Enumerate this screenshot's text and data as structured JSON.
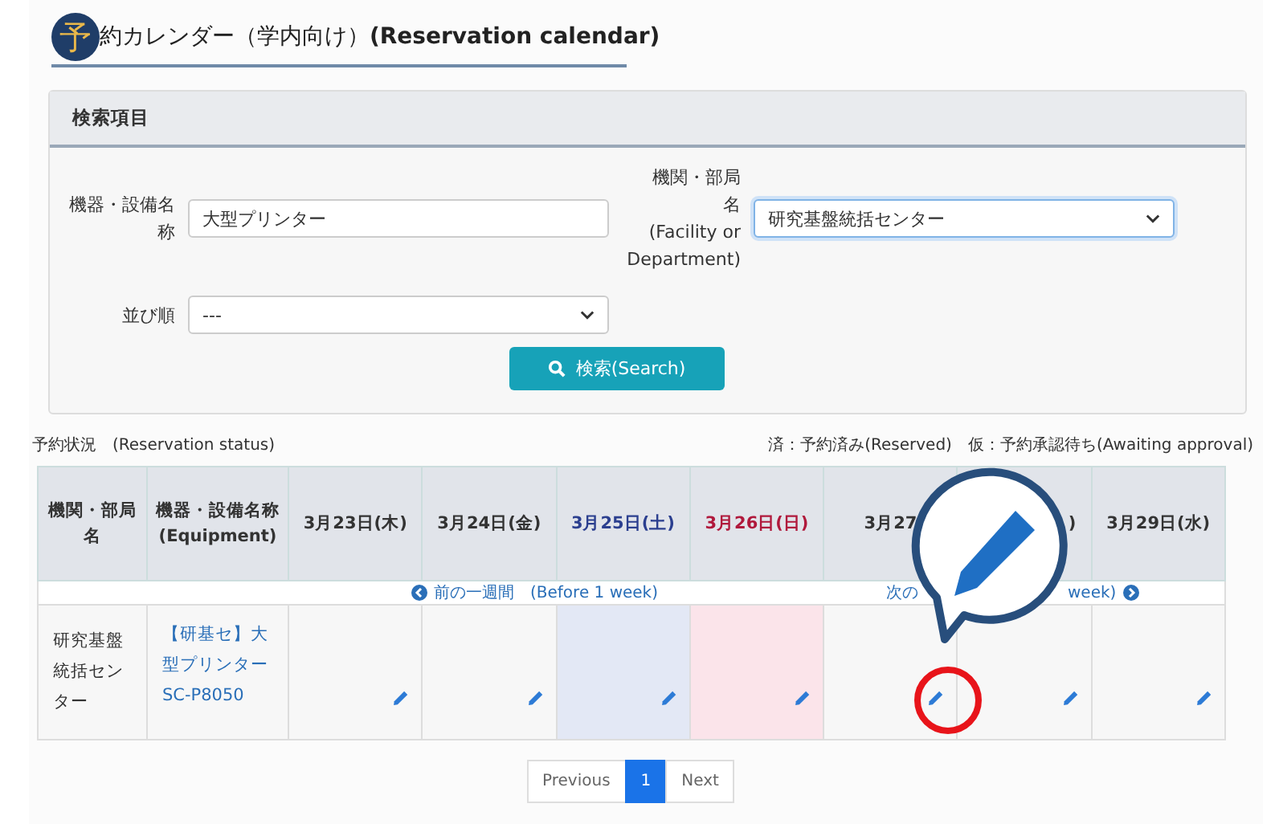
{
  "title": {
    "badge": "予",
    "text": "約カレンダー（学内向け）**(Reservation calendar)**"
  },
  "search": {
    "header": "検索項目",
    "equipment_label": "機器・設備名称",
    "equipment_value": "大型プリンター",
    "facility_label": [
      "機関・部局",
      "名",
      "(Facility or",
      "Department)"
    ],
    "facility_value": "研究基盤統括センター",
    "order_label": "並び順",
    "order_value": "---",
    "button": "検索(Search)"
  },
  "status": {
    "left": "予約状況　(Reservation status)",
    "legend": "済：予約済み(Reserved)　仮：予約承認待ち(Awaiting approval)"
  },
  "table": {
    "col_facility": "機関・部局名",
    "col_equipment": [
      "機器・設備名称",
      "(Equipment)"
    ],
    "days": [
      {
        "label": "3月23日(木)",
        "kind": "weekday",
        "head_hidden": false
      },
      {
        "label": "3月24日(金)",
        "kind": "weekday",
        "head_hidden": false
      },
      {
        "label": "3月25日(土)",
        "kind": "saturday",
        "head_hidden": false
      },
      {
        "label": "3月26日(日)",
        "kind": "sunday",
        "head_hidden": false
      },
      {
        "label": "3月27",
        "kind": "weekday",
        "head_hidden": false
      },
      {
        "label": ")",
        "kind": "weekday",
        "head_hidden": true
      },
      {
        "label": "3月29日(水)",
        "kind": "weekday",
        "head_hidden": false
      }
    ],
    "prev": "前の一週間　(Before 1 week)",
    "next_start": "次の",
    "next_end": "week)",
    "rows": [
      {
        "facility": "研究基盤統括センター",
        "equipment": "【研基セ】大型プリンター",
        "model": "SC-P8050"
      }
    ]
  },
  "pagination": [
    {
      "label": "Previous",
      "selected": false
    },
    {
      "label": "1",
      "selected": true
    },
    {
      "label": "Next",
      "selected": false
    }
  ]
}
